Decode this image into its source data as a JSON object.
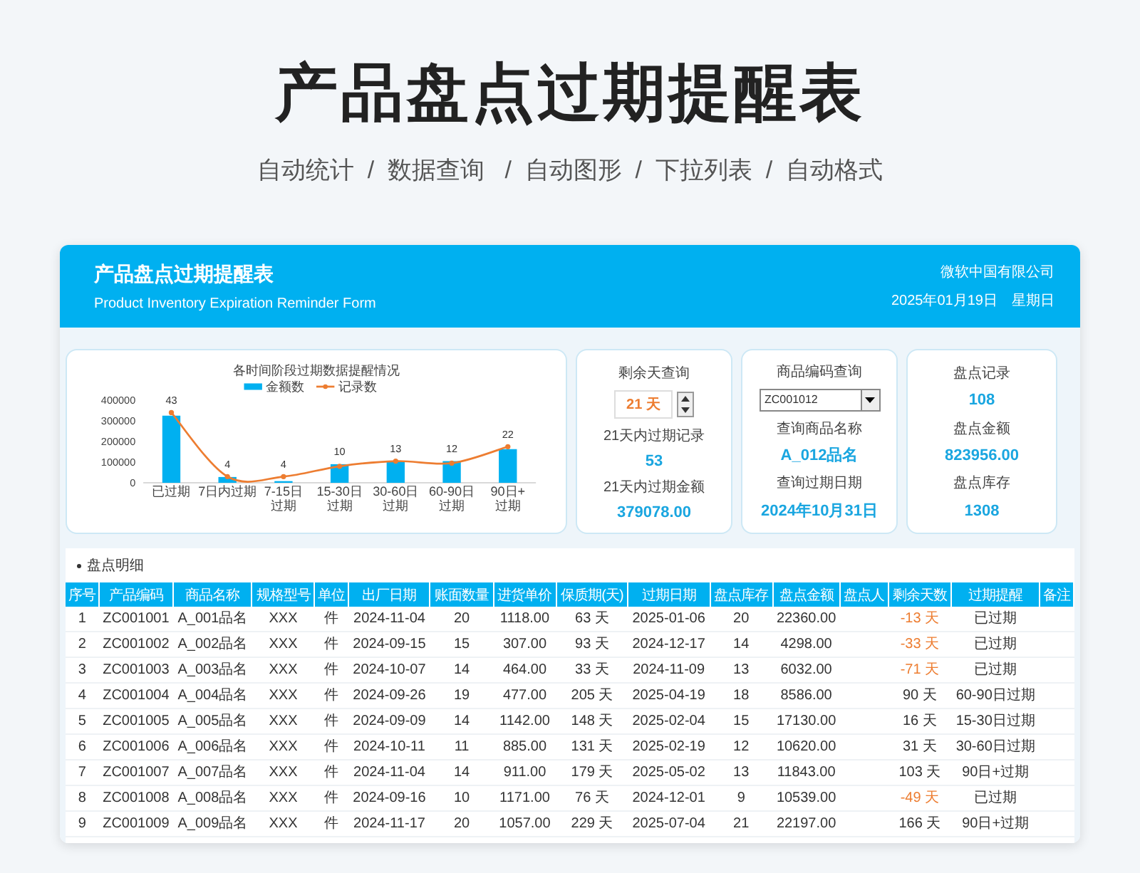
{
  "page_title": "产品盘点过期提醒表",
  "page_subtitle": "自动统计  /  数据查询   /  自动图形  /  下拉列表  /  自动格式",
  "header": {
    "title": "产品盘点过期提醒表",
    "subtitle": "Product Inventory Expiration Reminder Form",
    "company": "微软中国有限公司",
    "date": "2025年01月19日",
    "weekday": "星期日"
  },
  "chart": {
    "chart_data": {
      "type": "bar",
      "title": "各时间阶段过期数据提醒情况",
      "categories": [
        "已过期",
        "7日内过期",
        "7-15日过期",
        "15-30日过期",
        "30-60日过期",
        "60-90日过期",
        "90日+过期"
      ],
      "legend": "top",
      "ylim": [
        0,
        400000
      ],
      "yticks": [
        0,
        100000,
        200000,
        300000,
        400000
      ],
      "series": [
        {
          "name": "金额数",
          "type": "bar",
          "color": "#00b0f0",
          "values": [
            325000,
            28000,
            8000,
            90000,
            103000,
            105000,
            163000
          ]
        },
        {
          "name": "记录数",
          "type": "line",
          "marker": "circle",
          "color": "#ed7d31",
          "values": [
            340000,
            30000,
            30000,
            80000,
            105000,
            95000,
            175000
          ]
        }
      ]
    },
    "point_labels": [
      "43",
      "4",
      "4",
      "10",
      "13",
      "12",
      "22"
    ]
  },
  "days_query": {
    "title": "剩余天查询",
    "value": "21 天",
    "label_1": "21天内过期记录",
    "value_1": "53",
    "label_2": "21天内过期金额",
    "value_2": "379078.00"
  },
  "code_query": {
    "title": "商品编码查询",
    "value": "ZC001012",
    "label_1": "查询商品名称",
    "value_1": "A_012品名",
    "label_2": "查询过期日期",
    "value_2": "2024年10月31日"
  },
  "summary": [
    {
      "label": "盘点记录",
      "value": "108"
    },
    {
      "label": "盘点金额",
      "value": "823956.00"
    },
    {
      "label": "盘点库存",
      "value": "1308"
    }
  ],
  "table": {
    "section_title": "盘点明细",
    "columns": [
      "序号",
      "产品编码",
      "商品名称",
      "规格型号",
      "单位",
      "出厂日期",
      "账面数量",
      "进货单价",
      "保质期(天)",
      "过期日期",
      "盘点库存",
      "盘点金额",
      "盘点人",
      "剩余天数",
      "过期提醒",
      "备注"
    ],
    "rows": [
      {
        "cells": [
          "1",
          "ZC001001",
          "A_001品名",
          "XXX",
          "件",
          "2024-11-04",
          "20",
          "1118.00",
          "63 天",
          "2025-01-06",
          "20",
          "22360.00",
          "",
          "-13 天",
          "已过期",
          ""
        ],
        "expired": true
      },
      {
        "cells": [
          "2",
          "ZC001002",
          "A_002品名",
          "XXX",
          "件",
          "2024-09-15",
          "15",
          "307.00",
          "93 天",
          "2024-12-17",
          "14",
          "4298.00",
          "",
          "-33 天",
          "已过期",
          ""
        ],
        "expired": true
      },
      {
        "cells": [
          "3",
          "ZC001003",
          "A_003品名",
          "XXX",
          "件",
          "2024-10-07",
          "14",
          "464.00",
          "33 天",
          "2024-11-09",
          "13",
          "6032.00",
          "",
          "-71 天",
          "已过期",
          ""
        ],
        "expired": true
      },
      {
        "cells": [
          "4",
          "ZC001004",
          "A_004品名",
          "XXX",
          "件",
          "2024-09-26",
          "19",
          "477.00",
          "205 天",
          "2025-04-19",
          "18",
          "8586.00",
          "",
          "90 天",
          "60-90日过期",
          ""
        ],
        "expired": false
      },
      {
        "cells": [
          "5",
          "ZC001005",
          "A_005品名",
          "XXX",
          "件",
          "2024-09-09",
          "14",
          "1142.00",
          "148 天",
          "2025-02-04",
          "15",
          "17130.00",
          "",
          "16 天",
          "15-30日过期",
          ""
        ],
        "expired": false
      },
      {
        "cells": [
          "6",
          "ZC001006",
          "A_006品名",
          "XXX",
          "件",
          "2024-10-11",
          "11",
          "885.00",
          "131 天",
          "2025-02-19",
          "12",
          "10620.00",
          "",
          "31 天",
          "30-60日过期",
          ""
        ],
        "expired": false
      },
      {
        "cells": [
          "7",
          "ZC001007",
          "A_007品名",
          "XXX",
          "件",
          "2024-11-04",
          "14",
          "911.00",
          "179 天",
          "2025-05-02",
          "13",
          "11843.00",
          "",
          "103 天",
          "90日+过期",
          ""
        ],
        "expired": false
      },
      {
        "cells": [
          "8",
          "ZC001008",
          "A_008品名",
          "XXX",
          "件",
          "2024-09-16",
          "10",
          "1171.00",
          "76 天",
          "2024-12-01",
          "9",
          "10539.00",
          "",
          "-49 天",
          "已过期",
          ""
        ],
        "expired": true
      },
      {
        "cells": [
          "9",
          "ZC001009",
          "A_009品名",
          "XXX",
          "件",
          "2024-11-17",
          "20",
          "1057.00",
          "229 天",
          "2025-07-04",
          "21",
          "22197.00",
          "",
          "166 天",
          "90日+过期",
          ""
        ],
        "expired": false
      }
    ]
  }
}
